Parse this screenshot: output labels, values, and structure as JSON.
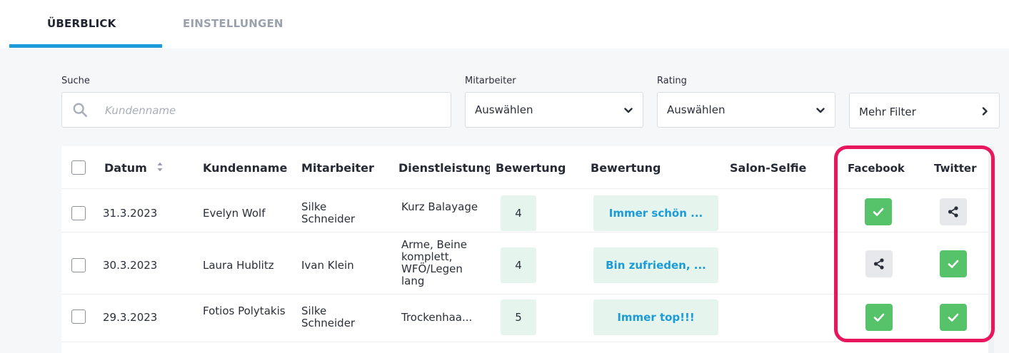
{
  "tabs": [
    {
      "label": "ÜBERBLICK",
      "active": true
    },
    {
      "label": "EINSTELLUNGEN",
      "active": false
    }
  ],
  "filters": {
    "search": {
      "label": "Suche",
      "placeholder": "Kundenname",
      "value": ""
    },
    "employee": {
      "label": "Mitarbeiter",
      "value": "Auswählen"
    },
    "rating": {
      "label": "Rating",
      "value": "Auswählen"
    },
    "more": {
      "label": "Mehr Filter"
    }
  },
  "table": {
    "columns": {
      "date": "Datum",
      "customer": "Kundenname",
      "employee": "Mitarbeiter",
      "service": "Dienstleistung",
      "rating": "Bewertung",
      "review": "Bewertung",
      "selfie": "Salon-Selfie",
      "facebook": "Facebook",
      "twitter": "Twitter"
    },
    "rows": [
      {
        "date": "31.3.2023",
        "customer": "Evelyn Wolf",
        "employee": "Silke Schneider",
        "service": "Kurz Balayage",
        "rating": "4",
        "review": "Immer schön ...",
        "facebook": "shared",
        "twitter": "share"
      },
      {
        "date": "30.3.2023",
        "customer": "Laura Hublitz",
        "employee": "Ivan Klein",
        "service": "Arme, Beine komplett, WFÖ/Legen lang",
        "rating": "4",
        "review": "Bin zufrieden, ...",
        "facebook": "share",
        "twitter": "shared"
      },
      {
        "date": "29.3.2023",
        "customer": "Fotios Polytakis",
        "employee": "Silke Schneider",
        "service": "Trockenhaa...",
        "rating": "5",
        "review": "Immer top!!!",
        "facebook": "shared",
        "twitter": "shared"
      }
    ]
  },
  "icons": {
    "search": "search-icon",
    "select_arrow": "chevron-down-icon",
    "more_arrow": "chevron-right-icon",
    "sort": "sort-icon",
    "shared": "checkmark-icon",
    "share": "share-icon"
  },
  "colors": {
    "accent": "#1b9cd8",
    "shared": "#56c36a",
    "share_bg": "#e6e8ec",
    "badge_bg": "#e5f4ec",
    "highlight": "#e8175d"
  }
}
